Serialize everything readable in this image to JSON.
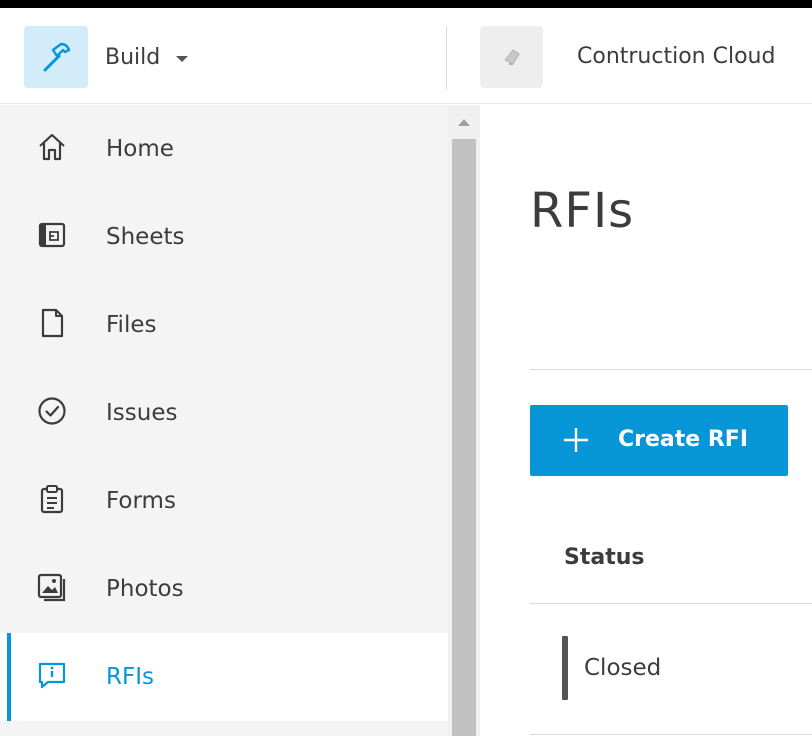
{
  "header": {
    "app_name": "Build",
    "app_icon": "hammer-icon",
    "project_icon": "project-thumbnail-icon",
    "project_name": "Contruction Cloud"
  },
  "sidebar": {
    "items": [
      {
        "label": "Home",
        "icon": "home-icon",
        "active": false
      },
      {
        "label": "Sheets",
        "icon": "sheets-icon",
        "active": false
      },
      {
        "label": "Files",
        "icon": "file-icon",
        "active": false
      },
      {
        "label": "Issues",
        "icon": "check-circle-icon",
        "active": false
      },
      {
        "label": "Forms",
        "icon": "clipboard-icon",
        "active": false
      },
      {
        "label": "Photos",
        "icon": "photos-icon",
        "active": false
      },
      {
        "label": "RFIs",
        "icon": "rfi-icon",
        "active": true
      }
    ]
  },
  "main": {
    "title": "RFIs",
    "create_button_label": "Create RFI",
    "table": {
      "columns": [
        "Status"
      ],
      "rows": [
        {
          "status": "Closed"
        }
      ]
    }
  },
  "colors": {
    "accent": "#0696d7",
    "app_icon_bg": "#d2ecf9",
    "sidebar_bg": "#f4f4f4",
    "status_closed": "#555555"
  }
}
